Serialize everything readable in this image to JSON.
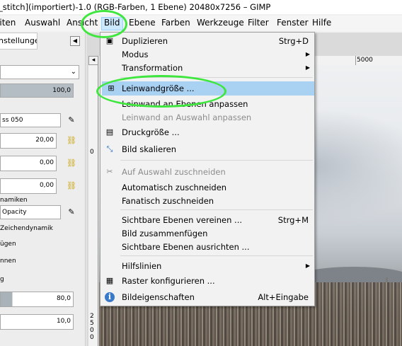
{
  "window": {
    "title": "_stitch](importiert)-1.0 (RGB-Farben, 1 Ebene) 20480x7256 – GIMP"
  },
  "menubar": {
    "items": [
      "eiten",
      "Auswahl",
      "Ansicht",
      "Bild",
      "Ebene",
      "Farben",
      "Werkzeuge",
      "Filter",
      "Fenster",
      "Hilfe"
    ]
  },
  "dock": {
    "tab_label": "nstellungen",
    "opacity_value": "100,0",
    "brush_name": "ss 050",
    "size_value": "20,00",
    "ratio_value": "0,00",
    "angle_value": "0,00",
    "dynamics_label": "namiken",
    "dynamics_value": "Opacity",
    "dyn_option": "Zeichendynamik",
    "opt1": "ügen",
    "opt2": "nnen",
    "opt3": "g",
    "val80": "80,0",
    "val10": "10,0"
  },
  "rulers": {
    "top_mark": "5000",
    "left_top": "0",
    "left_bottom": "2500"
  },
  "menu": {
    "items": [
      {
        "label": "Duplizieren",
        "shortcut": "Strg+D",
        "icon": "duplicate-icon"
      },
      {
        "label": "Modus",
        "submenu": true
      },
      {
        "label": "Transformation",
        "submenu": true
      },
      {
        "label": "Leinwandgröße ...",
        "icon": "canvas-size-icon",
        "highlighted": true
      },
      {
        "label": "Leinwand an Ebenen anpassen"
      },
      {
        "label": "Leinwand an Auswahl anpassen",
        "disabled": true
      },
      {
        "label": "Druckgröße ...",
        "icon": "print-size-icon"
      },
      {
        "label": "Bild skalieren",
        "icon": "scale-image-icon"
      },
      {
        "label": "Auf Auswahl zuschneiden",
        "icon": "crop-icon",
        "disabled": true
      },
      {
        "label": "Automatisch zuschneiden"
      },
      {
        "label": "Fanatisch zuschneiden"
      },
      {
        "label": "Sichtbare Ebenen vereinen ...",
        "shortcut": "Strg+M"
      },
      {
        "label": "Bild zusammenfügen"
      },
      {
        "label": "Sichtbare Ebenen ausrichten ..."
      },
      {
        "label": "Hilfslinien",
        "submenu": true
      },
      {
        "label": "Raster konfigurieren ...",
        "icon": "grid-icon"
      },
      {
        "label": "Bildeigenschaften",
        "shortcut": "Alt+Eingabe",
        "icon": "info-icon"
      }
    ]
  },
  "colors": {
    "highlight": "#a9d1f2",
    "annotation_circle": "#3ee63e"
  }
}
